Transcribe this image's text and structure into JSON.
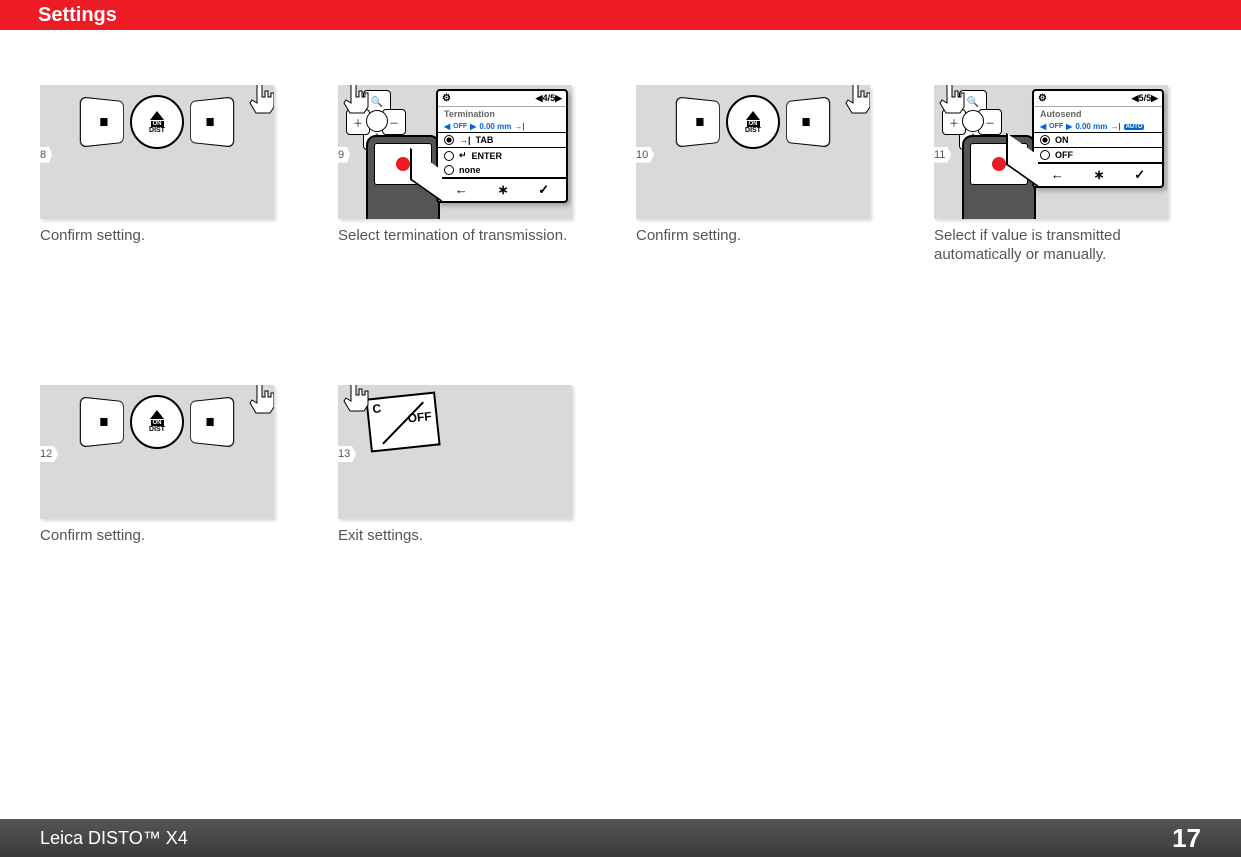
{
  "header": {
    "title": "Settings"
  },
  "steps": [
    {
      "num": "8",
      "caption": "Confirm setting."
    },
    {
      "num": "9",
      "caption": "Select termination of transmission.",
      "screen": {
        "page": "4/5",
        "title": "Termination",
        "value": "0.00 mm",
        "options": [
          {
            "icon": "tab",
            "label": "TAB",
            "selected": true
          },
          {
            "icon": "enter",
            "label": "ENTER",
            "selected": false
          },
          {
            "icon": "none",
            "label": "none",
            "selected": false
          }
        ]
      }
    },
    {
      "num": "10",
      "caption": "Confirm setting."
    },
    {
      "num": "11",
      "caption": "Select if value is transmitted automatically or manually.",
      "screen": {
        "page": "5/5",
        "title": "Autosend",
        "value": "0.00 mm",
        "options": [
          {
            "label": "ON",
            "selected": true
          },
          {
            "label": "OFF",
            "selected": false
          }
        ]
      }
    },
    {
      "num": "12",
      "caption": "Confirm setting."
    },
    {
      "num": "13",
      "caption": "Exit settings.",
      "coff": {
        "top": "C",
        "bottom": "OFF"
      }
    }
  ],
  "footer": {
    "product": "Leica DISTO™ X4",
    "page": "17"
  },
  "dist_button": {
    "line1": "ON",
    "line2": "DIST"
  }
}
